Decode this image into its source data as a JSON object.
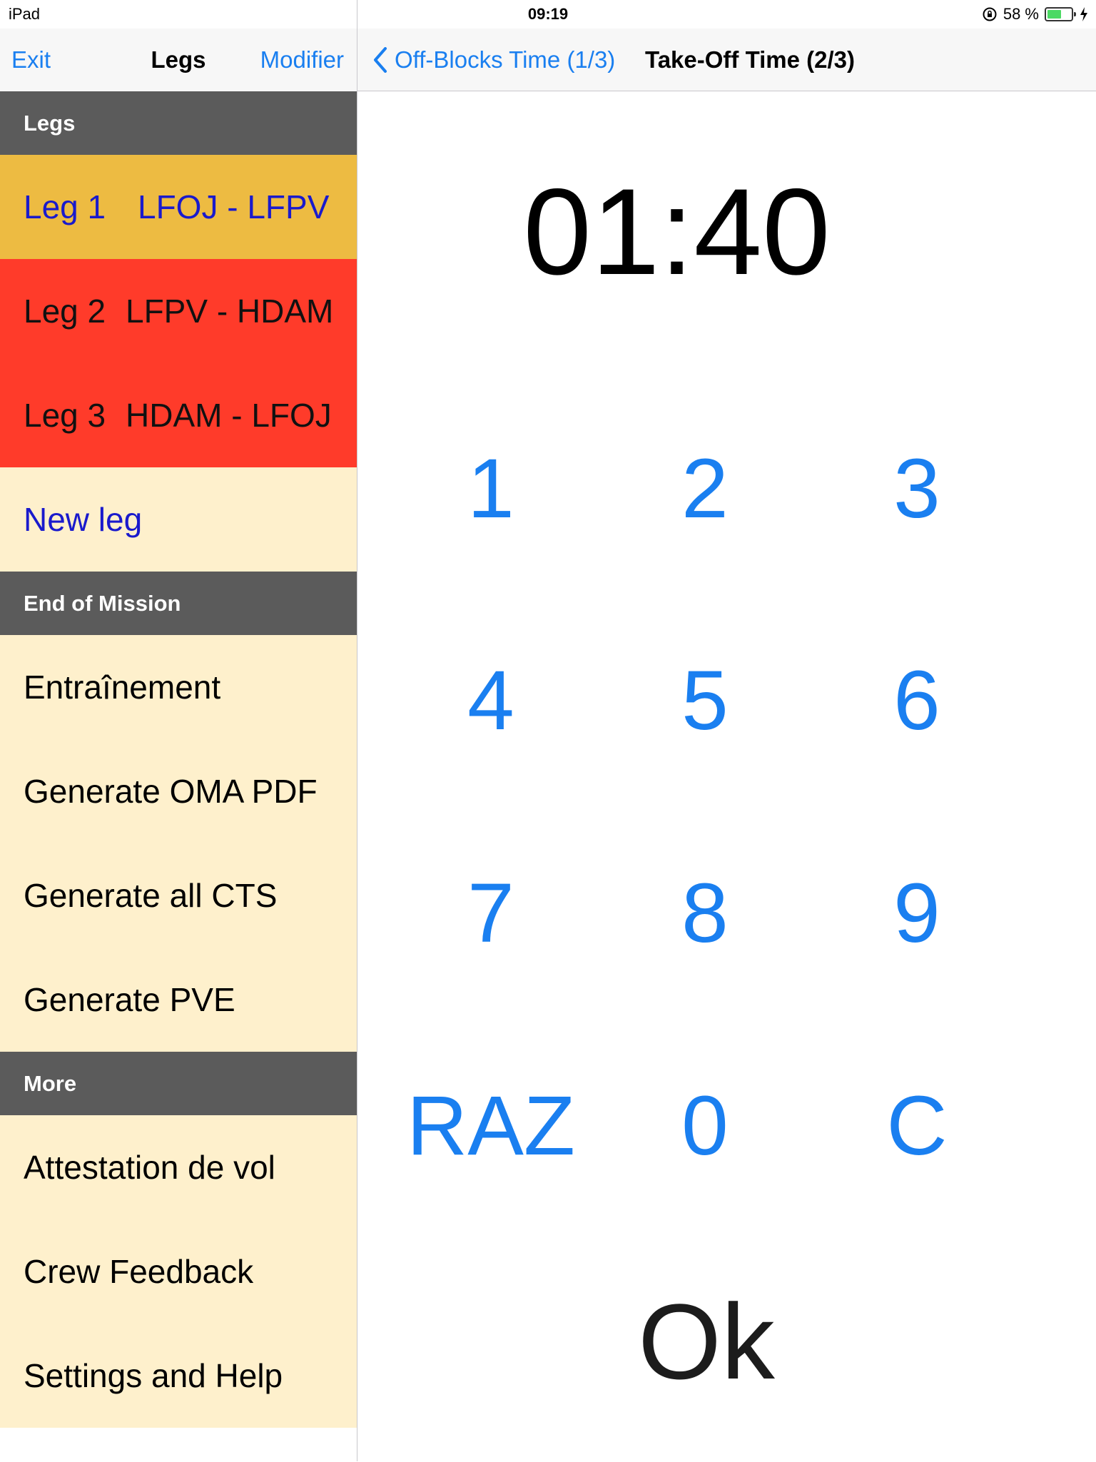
{
  "status_bar": {
    "device": "iPad",
    "time": "09:19",
    "battery": "58 %",
    "battery_level": 0.58
  },
  "left_nav": {
    "exit_label": "Exit",
    "title": "Legs",
    "edit_label": "Modifier"
  },
  "right_nav": {
    "back_label": "Off-Blocks Time (1/3)",
    "title": "Take-Off Time (2/3)"
  },
  "sections": {
    "legs": {
      "header": "Legs",
      "items": [
        {
          "num": "Leg 1",
          "route": "LFOJ - LFPV"
        },
        {
          "num": "Leg 2",
          "route": "LFPV - HDAM"
        },
        {
          "num": "Leg 3",
          "route": "HDAM - LFOJ"
        }
      ],
      "new_leg": "New leg"
    },
    "end_of_mission": {
      "header": "End of Mission",
      "items": [
        "Entraînement",
        "Generate OMA PDF",
        "Generate all CTS",
        "Generate PVE"
      ]
    },
    "more": {
      "header": "More",
      "items": [
        "Attestation de vol",
        "Crew Feedback",
        "Settings and Help"
      ]
    }
  },
  "keypad": {
    "display": "01:40",
    "keys": [
      "1",
      "2",
      "3",
      "4",
      "5",
      "6",
      "7",
      "8",
      "9",
      "RAZ",
      "0",
      "C"
    ],
    "ok_label": "Ok"
  },
  "colors": {
    "accent": "#1a7ff0",
    "section_header": "#5b5b5b",
    "leg_selected": "#edbb42",
    "leg_warning": "#ff3b2a",
    "row_background": "#fef0cc",
    "leg_text": "#1a1acc"
  },
  "icons": {
    "back": "chevron-left-icon",
    "orientation_lock": "orientation-lock-icon",
    "battery": "battery-icon",
    "charging": "charging-bolt-icon"
  }
}
